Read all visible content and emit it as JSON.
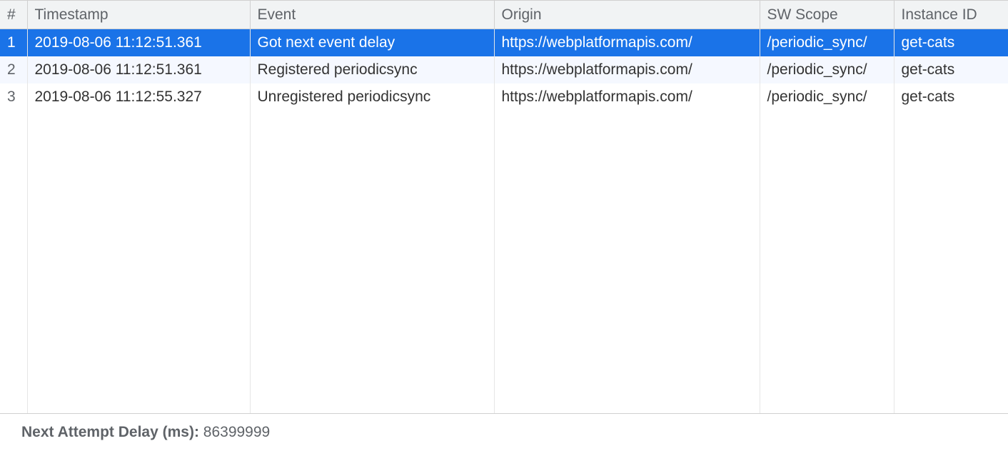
{
  "table": {
    "headers": {
      "index": "#",
      "timestamp": "Timestamp",
      "event": "Event",
      "origin": "Origin",
      "scope": "SW Scope",
      "instance": "Instance ID"
    },
    "rows": [
      {
        "index": "1",
        "timestamp": "2019-08-06 11:12:51.361",
        "event": "Got next event delay",
        "origin": "https://webplatformapis.com/",
        "scope": "/periodic_sync/",
        "instance": "get-cats"
      },
      {
        "index": "2",
        "timestamp": "2019-08-06 11:12:51.361",
        "event": "Registered periodicsync",
        "origin": "https://webplatformapis.com/",
        "scope": "/periodic_sync/",
        "instance": "get-cats"
      },
      {
        "index": "3",
        "timestamp": "2019-08-06 11:12:55.327",
        "event": "Unregistered periodicsync",
        "origin": "https://webplatformapis.com/",
        "scope": "/periodic_sync/",
        "instance": "get-cats"
      }
    ]
  },
  "footer": {
    "label": "Next Attempt Delay (ms): ",
    "value": "86399999"
  }
}
